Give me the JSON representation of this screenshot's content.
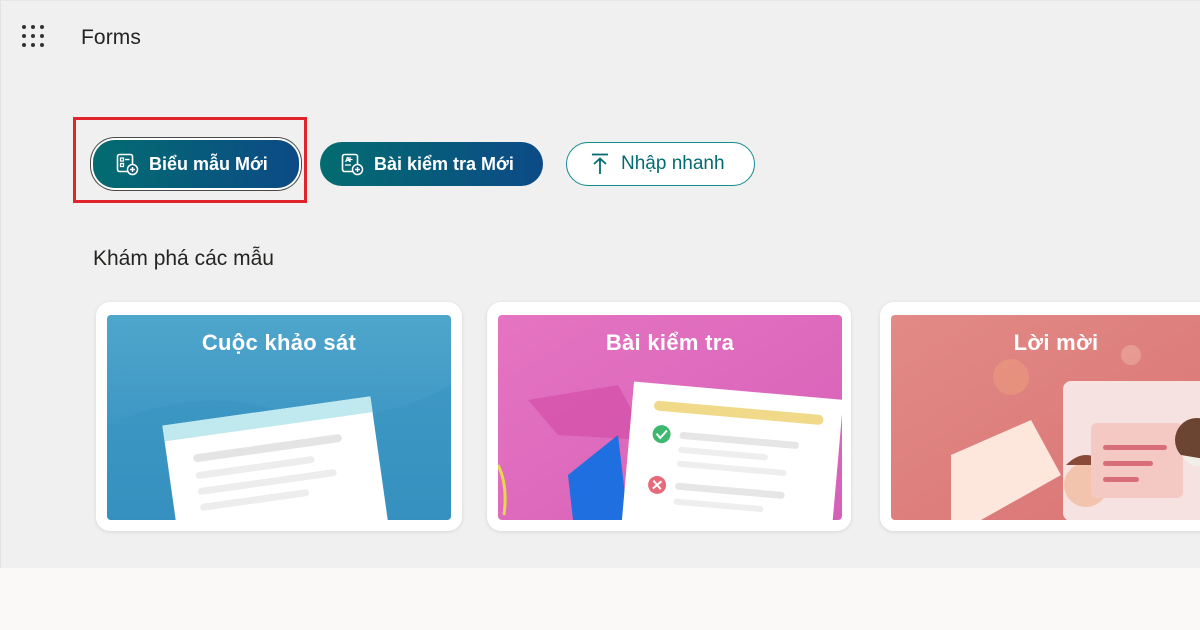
{
  "header": {
    "app_title": "Forms",
    "waffle_icon": "app-launcher-icon"
  },
  "actions": {
    "new_form_label": "Biểu mẫu Mới",
    "new_quiz_label": "Bài kiểm tra Mới",
    "quick_import_label": "Nhập nhanh"
  },
  "templates": {
    "section_title": "Khám phá các mẫu",
    "cards": [
      {
        "label": "Cuộc khảo sát",
        "color": "#4ba3c9"
      },
      {
        "label": "Bài kiểm tra",
        "color": "#e274c0"
      },
      {
        "label": "Lời mời",
        "color": "#e08886"
      }
    ]
  },
  "colors": {
    "button_gradient_start": "#036c70",
    "button_gradient_end": "#0c4a86",
    "highlight": "#e0242c"
  }
}
